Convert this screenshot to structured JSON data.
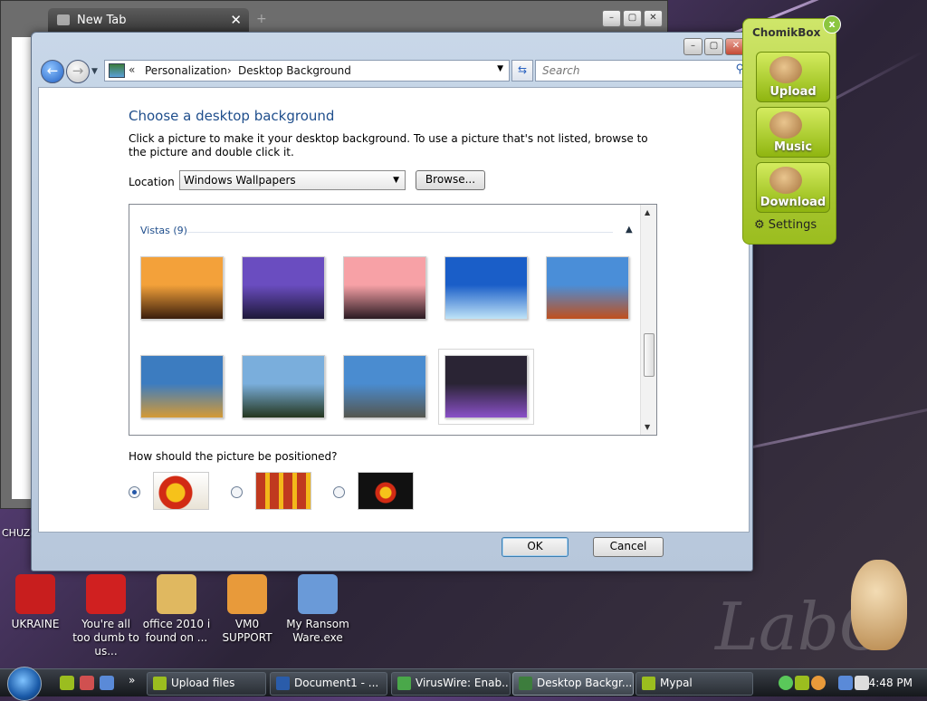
{
  "browser": {
    "tab_title": "New Tab",
    "tab_close": "✕",
    "new_tab": "+"
  },
  "window": {
    "breadcrumbs": [
      "Personalization",
      "Desktop Background"
    ],
    "chevron": "«",
    "search_placeholder": "Search",
    "heading": "Choose a desktop background",
    "description": "Click a picture to make it your desktop background. To use a picture that's not listed, browse to the picture and double click it.",
    "location_label": "Location",
    "location_value": "Windows Wallpapers",
    "browse_label": "Browse...",
    "group_label": "Vistas (9)",
    "thumbnails": [
      {
        "name": "sunset-rocks",
        "colors": [
          "#f3a13a",
          "#3a1d0c"
        ]
      },
      {
        "name": "city-bridge",
        "colors": [
          "#6a4dc0",
          "#1d1838"
        ]
      },
      {
        "name": "sea-sunset",
        "colors": [
          "#f7a1a6",
          "#2a1a22"
        ]
      },
      {
        "name": "tropical-pier",
        "colors": [
          "#1a5ec8",
          "#bfe3f7"
        ]
      },
      {
        "name": "rock-arch",
        "colors": [
          "#4a8ed8",
          "#c0501e"
        ]
      },
      {
        "name": "desert-plain",
        "colors": [
          "#3c7cc0",
          "#d49a35"
        ]
      },
      {
        "name": "mountain-lake",
        "colors": [
          "#7aaedc",
          "#24361e"
        ]
      },
      {
        "name": "cliff-clouds",
        "colors": [
          "#4a8cd0",
          "#55564e"
        ]
      },
      {
        "name": "purple-streaks",
        "colors": [
          "#2a2434",
          "#8a50c8"
        ]
      }
    ],
    "position_question": "How should the picture be positioned?",
    "position_selected": 0,
    "ok_label": "OK",
    "cancel_label": "Cancel",
    "accent": "#1f4e8c"
  },
  "chomikbox": {
    "title": "ChomikBox",
    "close": "x",
    "buttons": [
      "Upload",
      "Music",
      "Download"
    ],
    "settings_label": "Settings"
  },
  "desktop": {
    "icons": [
      {
        "label": "UKRAINE",
        "color": "#c81e1e"
      },
      {
        "label": "You're all too dumb to us...",
        "color": "#d02020"
      },
      {
        "label": "office 2010 i found on ...",
        "color": "#e0b860"
      },
      {
        "label": "VM0 SUPPORT",
        "color": "#e89a3a"
      },
      {
        "label": "My Ransom Ware.exe",
        "color": "#6a9ad8"
      }
    ],
    "left_edge_label": "CHUZ",
    "watermark": "LabC"
  },
  "taskbar": {
    "items": [
      {
        "label": "Upload files",
        "color": "#9bbd1f",
        "active": false
      },
      {
        "label": "Document1 - ...",
        "color": "#2a5caa",
        "active": false
      },
      {
        "label": "VirusWire: Enab...",
        "color": "#4aa84a",
        "active": false
      },
      {
        "label": "Desktop Backgr...",
        "color": "#3d7d3d",
        "active": true
      },
      {
        "label": "Mypal",
        "color": "#9bbd1f",
        "active": false
      }
    ],
    "clock": "4:48 PM"
  }
}
